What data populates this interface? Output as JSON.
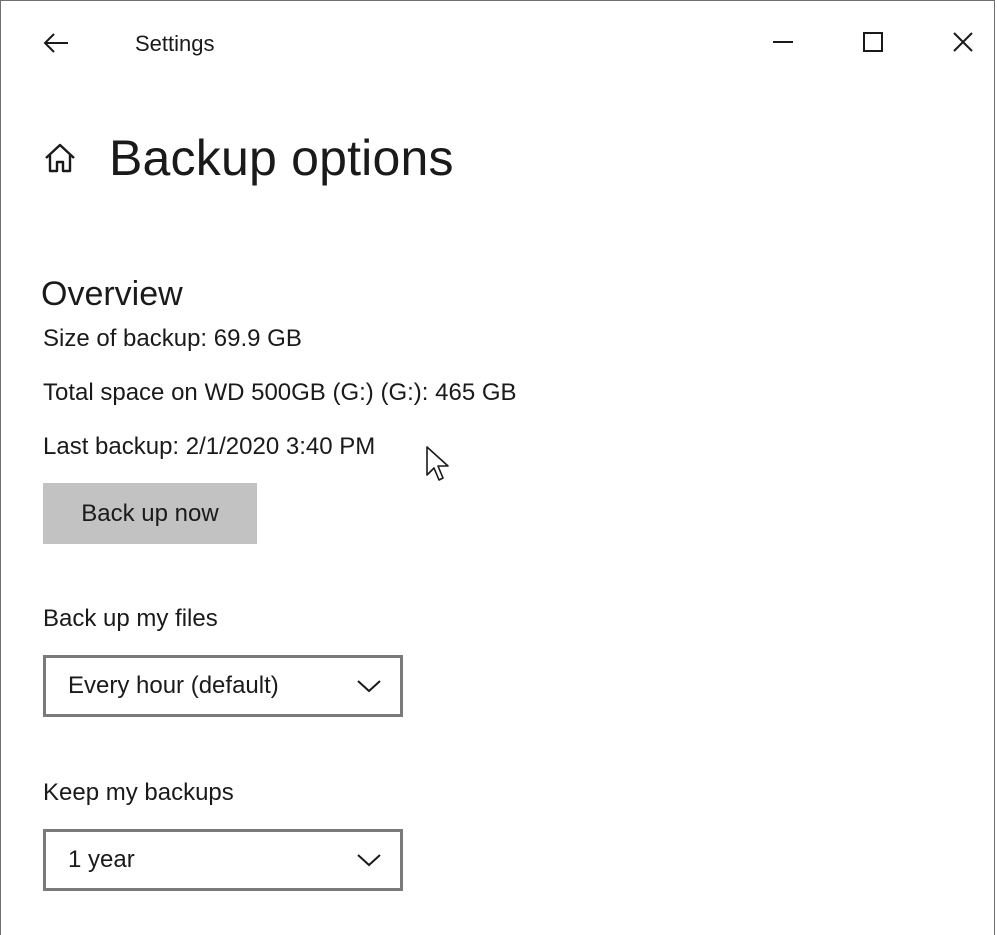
{
  "window": {
    "title": "Settings",
    "controls": {
      "back": "back-arrow-icon",
      "minimize": "minimize-icon",
      "maximize": "maximize-icon",
      "close": "close-icon"
    }
  },
  "page": {
    "title": "Backup options",
    "home_icon": "home-icon"
  },
  "overview": {
    "heading": "Overview",
    "size_of_backup": "Size of backup: 69.9 GB",
    "total_space": "Total space on WD 500GB (G:) (G:): 465 GB",
    "last_backup": "Last backup: 2/1/2020 3:40 PM",
    "back_up_now_label": "Back up now"
  },
  "backup_frequency": {
    "label": "Back up my files",
    "selected": "Every hour (default)"
  },
  "retention": {
    "label": "Keep my backups",
    "selected": "1 year"
  },
  "colors": {
    "button_bg": "#c2c2c2",
    "dropdown_border": "#7a7a7a",
    "text": "#1a1a1a"
  }
}
